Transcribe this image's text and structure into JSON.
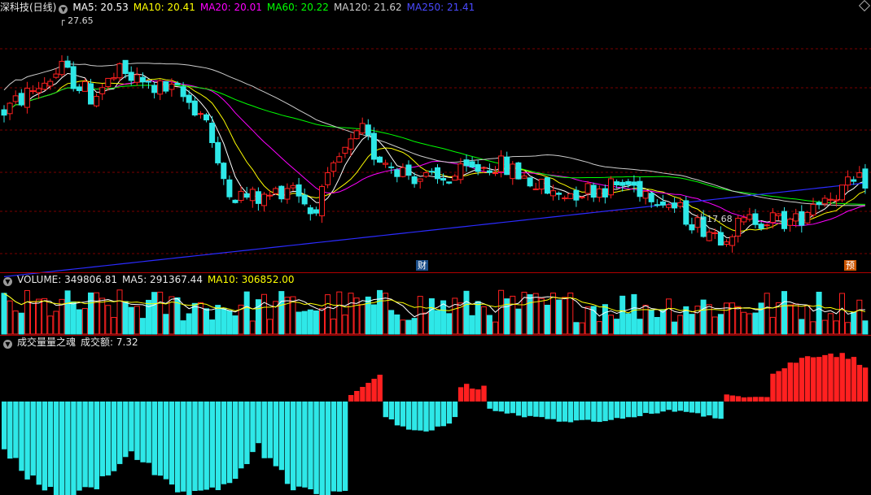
{
  "price_panel": {
    "title": "深科技(日线)",
    "mas": [
      {
        "label": "MA5: 20.53",
        "color": "#ffffff"
      },
      {
        "label": "MA10: 20.41",
        "color": "#ffff00"
      },
      {
        "label": "MA20: 20.01",
        "color": "#ff00ff"
      },
      {
        "label": "MA60: 20.22",
        "color": "#00ff00"
      },
      {
        "label": "MA120: 21.62",
        "color": "#cccccc"
      },
      {
        "label": "MA250: 21.41",
        "color": "#3a3aff"
      }
    ],
    "high_label": "27.65",
    "low_label": "17.68",
    "badge_cai": "财",
    "badge_yu": "预"
  },
  "volume_panel": {
    "title": "VOLUME: 349806.81",
    "ma5": "MA5: 291367.44",
    "ma10": "MA10: 306852.00"
  },
  "indicator_panel": {
    "title": "成交量量之魂",
    "value": "成交额: 7.32"
  },
  "colors": {
    "up": "#ff2020",
    "down": "#2ee8e8",
    "grid": "#7a0000",
    "ma250": "#2b2bff"
  }
}
